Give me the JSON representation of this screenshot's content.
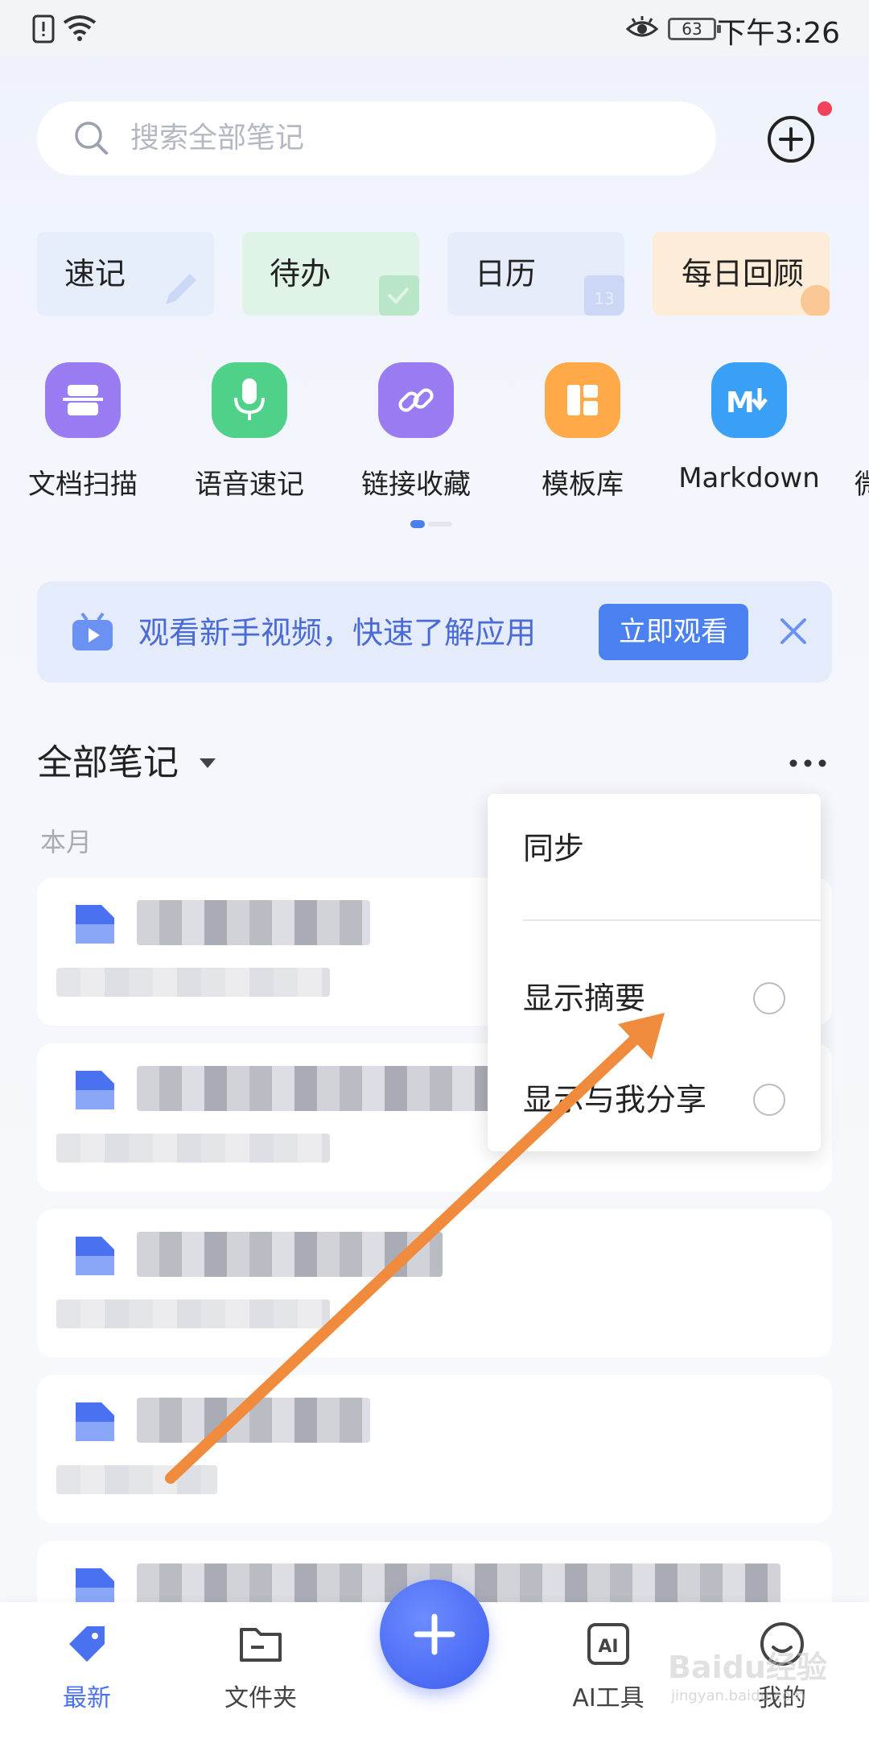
{
  "status_bar": {
    "time": "下午3:26",
    "battery": "63"
  },
  "search": {
    "placeholder": "搜索全部笔记"
  },
  "quick_cards": [
    {
      "label": "速记",
      "bg": "#e6eefb",
      "deco": "#c9d9f5"
    },
    {
      "label": "待办",
      "bg": "#dff3e6",
      "deco": "#b9e6c9"
    },
    {
      "label": "日历",
      "bg": "#e6ecfa",
      "deco": "#cbd7f5"
    },
    {
      "label": "每日回顾",
      "bg": "#fdecd8",
      "deco": "#fbd2a6"
    }
  ],
  "features": [
    {
      "label": "文档扫描",
      "icon": "scan-icon",
      "color": "#9a7cf2"
    },
    {
      "label": "语音速记",
      "icon": "mic-icon",
      "color": "#4fd18a"
    },
    {
      "label": "链接收藏",
      "icon": "link-icon",
      "color": "#9a7cf2"
    },
    {
      "label": "模板库",
      "icon": "template-icon",
      "color": "#ffa948"
    },
    {
      "label": "Markdown",
      "icon": "markdown-icon",
      "color": "#3aa0f5"
    },
    {
      "label": "微",
      "icon": "partial-icon",
      "color": "#cccccc"
    }
  ],
  "banner": {
    "text": "观看新手视频，快速了解应用",
    "button": "立即观看"
  },
  "section": {
    "title": "全部笔记",
    "month": "本月"
  },
  "menu": {
    "items": [
      {
        "label": "同步"
      },
      {
        "label": "显示摘要"
      },
      {
        "label": "显示与我分享"
      }
    ]
  },
  "nav": [
    {
      "label": "最新",
      "active": true
    },
    {
      "label": "文件夹",
      "active": false
    },
    {
      "label": "AI工具",
      "active": false
    },
    {
      "label": "我的",
      "active": false
    }
  ],
  "watermark": {
    "brand": "Baidu经验",
    "url": "jingyan.baidu.com"
  },
  "colors": {
    "accent": "#4a80f0",
    "arrow": "#f08a3c"
  }
}
